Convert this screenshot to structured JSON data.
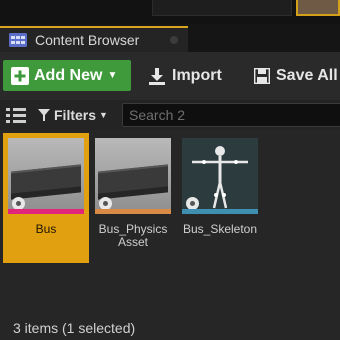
{
  "tab": {
    "title": "Content Browser"
  },
  "toolbar": {
    "add_new": "Add New",
    "import": "Import",
    "save_all": "Save All"
  },
  "filters": {
    "label": "Filters",
    "search_placeholder": "Search 2"
  },
  "assets": [
    {
      "name": "Bus",
      "type": "skeletal-mesh",
      "selected": true,
      "stripe_color": "#e0257a"
    },
    {
      "name": "Bus_Physics Asset",
      "type": "physics-asset",
      "selected": false,
      "stripe_color": "#d98a46"
    },
    {
      "name": "Bus_Skeleton",
      "type": "skeleton",
      "selected": false,
      "stripe_color": "#3e8fb0"
    }
  ],
  "status": {
    "text": "3 items (1 selected)"
  },
  "colors": {
    "accent": "#d9a520",
    "add_new": "#3e9a3a",
    "selection": "#e0a010"
  }
}
